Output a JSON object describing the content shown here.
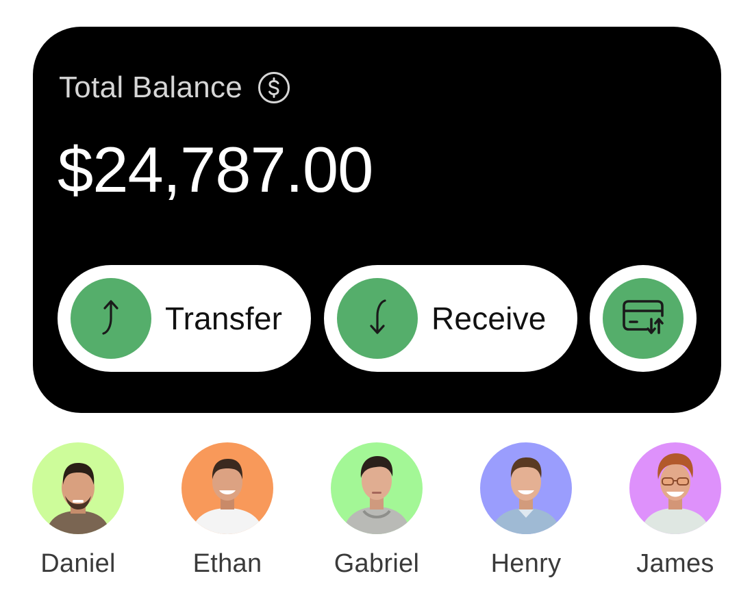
{
  "balance": {
    "label": "Total Balance",
    "amount": "$24,787.00"
  },
  "actions": [
    {
      "label": "Transfer",
      "icon": "arrow-up-curved-icon"
    },
    {
      "label": "Receive",
      "icon": "arrow-down-curved-icon"
    },
    {
      "label": "",
      "icon": "card-exchange-icon"
    }
  ],
  "contacts": [
    {
      "name": "Daniel",
      "bg": "#cdfc9a"
    },
    {
      "name": "Ethan",
      "bg": "#f8995a"
    },
    {
      "name": "Gabriel",
      "bg": "#a3f796"
    },
    {
      "name": "Henry",
      "bg": "#9a9dfd"
    },
    {
      "name": "James",
      "bg": "#de91fb"
    }
  ],
  "colors": {
    "card": "#000000",
    "accent": "#55ae6b",
    "pill": "#ffffff"
  }
}
